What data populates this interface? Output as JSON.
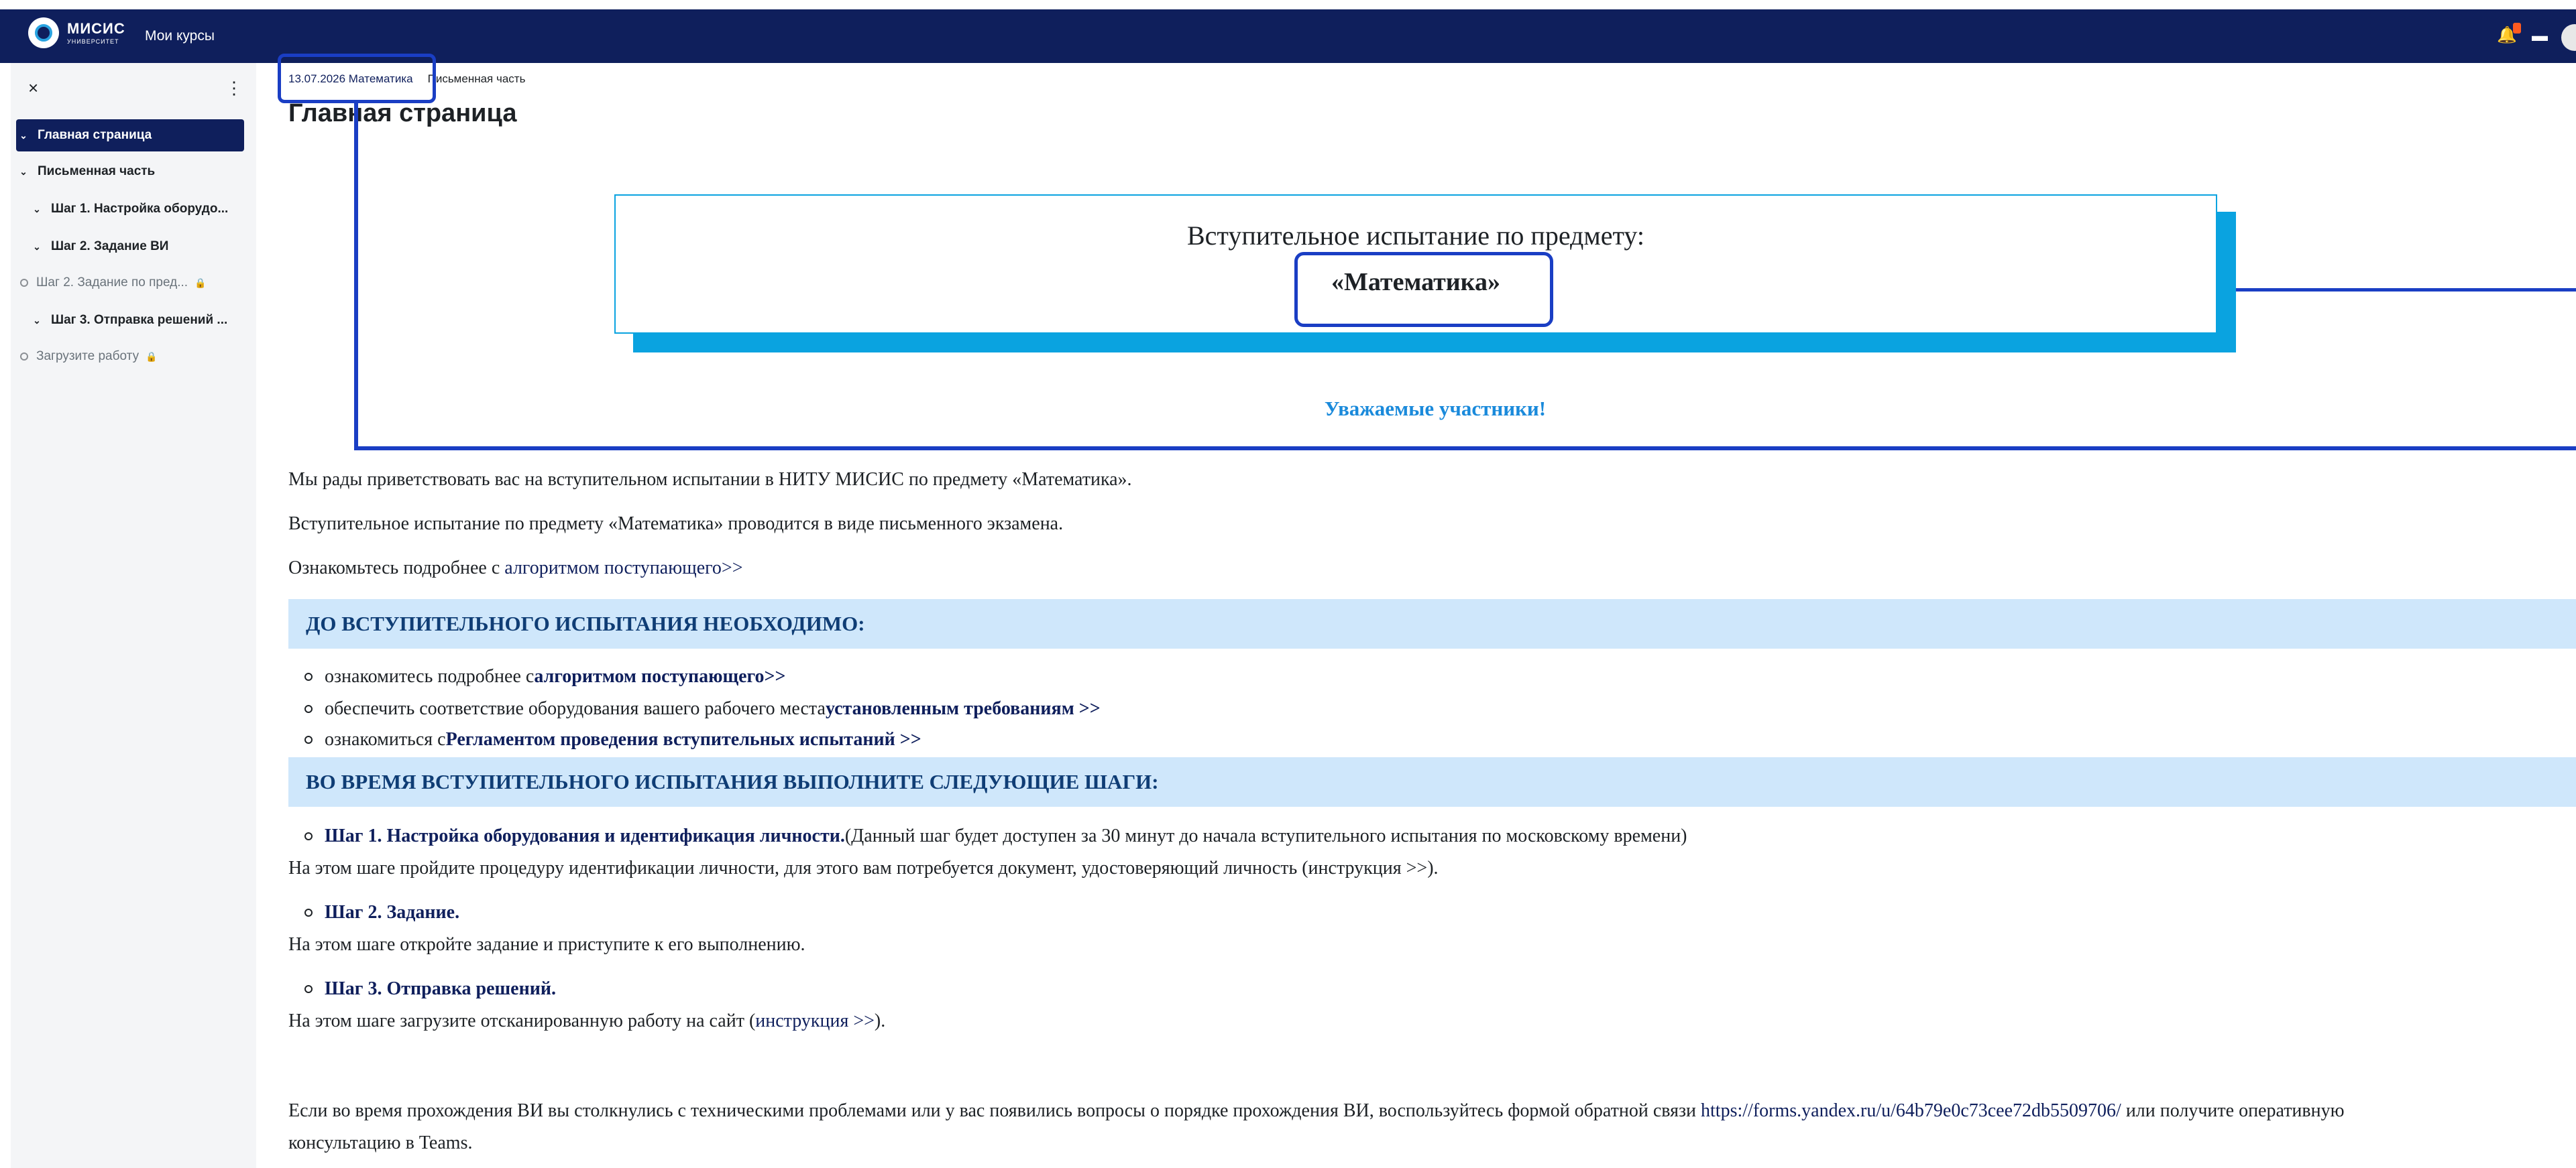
{
  "header": {
    "logo_name": "МИСИС",
    "logo_sub": "УНИВЕРСИТЕТ",
    "nav_courses": "Мои курсы"
  },
  "sidebar": {
    "items": [
      {
        "label": "Главная страница"
      },
      {
        "label": "Письменная часть"
      },
      {
        "label": "Шаг 1. Настройка оборудо..."
      },
      {
        "label": "Шаг 2. Задание ВИ"
      },
      {
        "label": "Шаг 2. Задание по пред..."
      },
      {
        "label": "Шаг 3. Отправка решений ..."
      },
      {
        "label": "Загрузите работу"
      }
    ]
  },
  "breadcrumb": {
    "item1": "13.07.2026 Математика",
    "item2": "Письменная часть"
  },
  "page": {
    "title": "Главная страница",
    "banner_title": "Вступительное испытание по предмету:",
    "banner_subject": "«Математика»",
    "greeting": "Уважаемые участники!",
    "p1": "Мы рады приветствовать вас на вступительном испытании в НИТУ МИСИС по предмету «Математика».",
    "p2": "Вступительное испытание по предмету «Математика» проводится в виде письменного экзамена.",
    "p3_text": "Ознакомьтесь подробнее с ",
    "p3_link": "алгоритмом поступающего>>",
    "section1": "ДО ВСТУПИТЕЛЬНОГО ИСПЫТАНИЯ НЕОБХОДИМО:",
    "list1": [
      {
        "text": "ознакомитесь подробнее с ",
        "link": "алгоритмом поступающего>>"
      },
      {
        "text": "обеспечить соответствие оборудования вашего рабочего места ",
        "link": "установленным требованиям >>"
      },
      {
        "text": "ознакомиться с ",
        "link": "Регламентом проведения вступительных испытаний >>"
      }
    ],
    "section2": "ВО ВРЕМЯ ВСТУПИТЕЛЬНОГО ИСПЫТАНИЯ ВЫПОЛНИТЕ СЛЕДУЮЩИЕ ШАГИ:",
    "step1_title": "Шаг 1. Настройка оборудования и идентификация личности.",
    "step1_note": " (Данный шаг будет доступен за 30 минут до начала вступительного испытания по московскому времени)",
    "step1_desc": "На этом шаге пройдите процедуру идентификации личности, для этого вам потребуется документ, удостоверяющий личность (инструкция >>).",
    "step2_title": "Шаг 2. Задание.",
    "step2_desc": "На этом шаге откройте задание и приступите к его выполнению.",
    "step3_title": "Шаг 3. Отправка решений.",
    "step3_desc_a": "На этом шаге загрузите отсканированную работу на сайт (",
    "step3_link": "инструкция >>",
    "step3_desc_b": ").",
    "footer_a": "Если во время прохождения ВИ вы столкнулись с техническими проблемами или у вас появились вопросы о порядке прохождения ВИ, воспользуйтесь формой обратной связи ",
    "footer_link": "https://forms.yandex.ru/u/64b79e0c73cee72db5509706/",
    "footer_b": "  или получите оперативную",
    "footer_c": "консультацию в Teams."
  }
}
